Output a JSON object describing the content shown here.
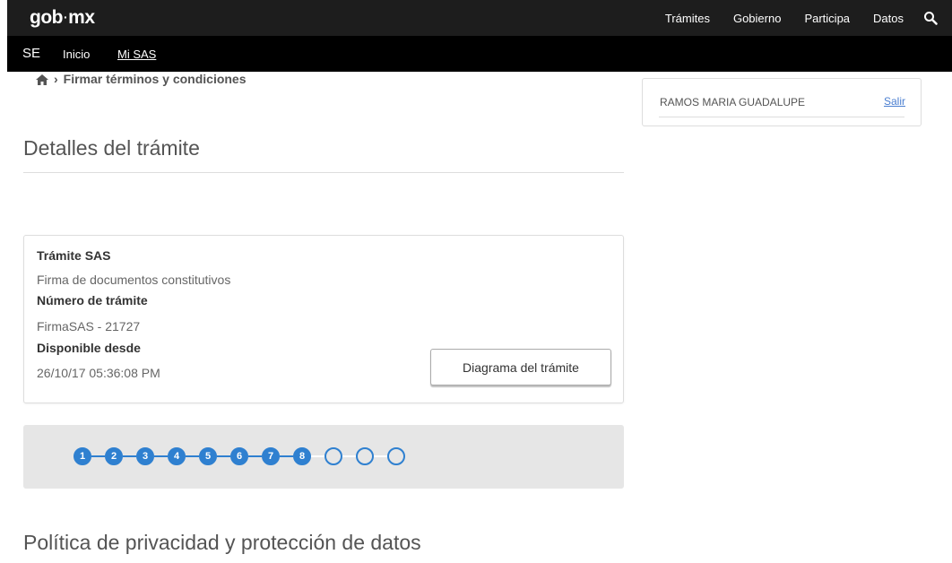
{
  "header": {
    "logo_main": "gob",
    "logo_dot": "·",
    "logo_suffix": "mx",
    "nav": [
      "Trámites",
      "Gobierno",
      "Participa",
      "Datos"
    ],
    "search_icon": "search-icon"
  },
  "subheader": {
    "brand": "SE",
    "links": [
      "Inicio",
      "Mi SAS"
    ],
    "active_link": "Mi SAS"
  },
  "breadcrumb": {
    "home_icon": "home-icon",
    "separator": "›",
    "current": "Firmar términos y condiciones"
  },
  "user": {
    "name": "RAMOS MARIA GUADALUPE",
    "logout": "Salir"
  },
  "section_title": "Detalles del trámite",
  "card": {
    "tramite_label": "Trámite SAS",
    "tramite_value": "Firma de documentos constitutivos",
    "numero_label": "Número de trámite",
    "numero_value": "FirmaSAS - 21727",
    "disponible_label": "Disponible desde",
    "disponible_value": "26/10/17 05:36:08 PM",
    "button": "Diagrama del trámite"
  },
  "stepper": {
    "steps": [
      "1",
      "2",
      "3",
      "4",
      "5",
      "6",
      "7",
      "8",
      "",
      "",
      ""
    ],
    "completed": 8,
    "accent": "#2f80d0"
  },
  "privacy_title": "Política de privacidad y protección de datos"
}
